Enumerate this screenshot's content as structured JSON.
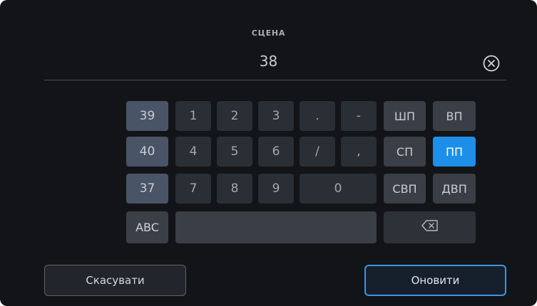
{
  "field": {
    "title": "СЦЕНА",
    "value": "38"
  },
  "icons": {
    "clear": "clear-x-circle-icon",
    "backspace": "backspace-icon"
  },
  "keypad": {
    "scene_keys": [
      "39",
      "40",
      "37"
    ],
    "digits": [
      "1",
      "2",
      "3",
      "4",
      "5",
      "6",
      "7",
      "8",
      "9",
      "0"
    ],
    "punctuation": [
      ".",
      "-",
      "/",
      ","
    ],
    "suffixes": [
      "ШП",
      "ВП",
      "СП",
      "ПП",
      "СВП",
      "ДВП"
    ],
    "active_suffix": "ПП",
    "abc_label": "ABC"
  },
  "buttons": {
    "cancel": "Скасувати",
    "update": "Оновити"
  },
  "colors": {
    "accent": "#1d8fe8",
    "background": "#121417"
  }
}
